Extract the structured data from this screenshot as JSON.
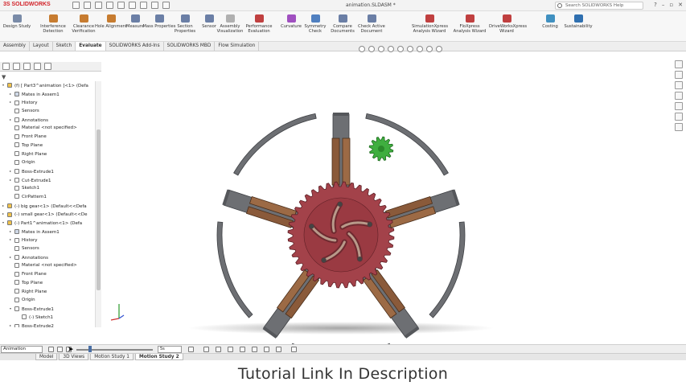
{
  "app": {
    "logo": "3S SOLIDWORKS",
    "document_title": "animation.SLDASM *",
    "search_placeholder": "Search SOLIDWORKS Help"
  },
  "ribbon": {
    "buttons": [
      {
        "label": "Design Study",
        "icon": "design-study-icon",
        "color": "#7a8ba8"
      },
      {
        "label": "Interference Detection",
        "icon": "interference-icon",
        "color": "#c77c30"
      },
      {
        "label": "Clearance Verification",
        "icon": "clearance-icon",
        "color": "#c77c30"
      },
      {
        "label": "Hole Alignment",
        "icon": "hole-icon",
        "color": "#c77c30"
      },
      {
        "label": "Measure",
        "icon": "measure-icon",
        "color": "#6b7fa6"
      },
      {
        "label": "Mass Properties",
        "icon": "mass-icon",
        "color": "#6b7fa6"
      },
      {
        "label": "Section Properties",
        "icon": "section-icon",
        "color": "#6b7fa6"
      },
      {
        "label": "Sensor",
        "icon": "sensor-icon",
        "color": "#6b7fa6"
      },
      {
        "label": "Assembly Visualization",
        "icon": "visualization-icon",
        "color": "#b0b0b0"
      },
      {
        "label": "Performance Evaluation",
        "icon": "performance-icon",
        "color": "#c04040"
      },
      {
        "label": "Curvature",
        "icon": "curvature-icon",
        "color": "#a050c0"
      },
      {
        "label": "Symmetry Check",
        "icon": "symmetry-icon",
        "color": "#5080c0"
      },
      {
        "label": "Compare Documents",
        "icon": "compare-icon",
        "color": "#6b7fa6"
      },
      {
        "label": "Check Active Document",
        "icon": "check-icon",
        "color": "#6b7fa6"
      },
      {
        "label": "SimulationXpress Analysis Wizard",
        "icon": "simxpress-icon",
        "color": "#c04040"
      },
      {
        "label": "FloXpress Analysis Wizard",
        "icon": "floxpress-icon",
        "color": "#c04040"
      },
      {
        "label": "DriveWorksXpress Wizard",
        "icon": "driveworks-icon",
        "color": "#c04040"
      },
      {
        "label": "Costing",
        "icon": "costing-icon",
        "color": "#4090c0"
      },
      {
        "label": "Sustainability",
        "icon": "sustainability-icon",
        "color": "#3070b0"
      }
    ]
  },
  "command_tabs": [
    "Assembly",
    "Layout",
    "Sketch",
    "Evaluate",
    "SOLIDWORKS Add-Ins",
    "SOLIDWORKS MBD",
    "Flow Simulation"
  ],
  "active_command_tab": "Evaluate",
  "tree": {
    "items": [
      {
        "label": "(f) [ Part3^animation ]<1> (Defa",
        "indent": 0,
        "arrow": "▾",
        "icon": "part-icon"
      },
      {
        "label": "Mates in Assem1",
        "indent": 1,
        "arrow": "▸",
        "icon": "mates-icon"
      },
      {
        "label": "History",
        "indent": 1,
        "arrow": "▸",
        "icon": "history-icon"
      },
      {
        "label": "Sensors",
        "indent": 1,
        "arrow": "",
        "icon": "sensors-icon"
      },
      {
        "label": "Annotations",
        "indent": 1,
        "arrow": "▸",
        "icon": "annotations-icon"
      },
      {
        "label": "Material <not specified>",
        "indent": 1,
        "arrow": "",
        "icon": "material-icon"
      },
      {
        "label": "Front Plane",
        "indent": 1,
        "arrow": "",
        "icon": "plane-icon"
      },
      {
        "label": "Top Plane",
        "indent": 1,
        "arrow": "",
        "icon": "plane-icon"
      },
      {
        "label": "Right Plane",
        "indent": 1,
        "arrow": "",
        "icon": "plane-icon"
      },
      {
        "label": "Origin",
        "indent": 1,
        "arrow": "",
        "icon": "origin-icon"
      },
      {
        "label": "Boss-Extrude1",
        "indent": 1,
        "arrow": "▸",
        "icon": "extrude-icon"
      },
      {
        "label": "Cut-Extrude1",
        "indent": 1,
        "arrow": "▸",
        "icon": "cut-icon"
      },
      {
        "label": "Sketch1",
        "indent": 1,
        "arrow": "",
        "icon": "sketch-icon"
      },
      {
        "label": "CirPattern1",
        "indent": 1,
        "arrow": "",
        "icon": "pattern-icon"
      },
      {
        "label": "(-) big gear<1> (Default<<Defa",
        "indent": 0,
        "arrow": "▸",
        "icon": "part-icon"
      },
      {
        "label": "(-) small gear<1> (Default<<De",
        "indent": 0,
        "arrow": "▸",
        "icon": "part-icon"
      },
      {
        "label": "(-) Part1^animation<1> (Defa",
        "indent": 0,
        "arrow": "▾",
        "icon": "part-icon"
      },
      {
        "label": "Mates in Assem1",
        "indent": 1,
        "arrow": "▸",
        "icon": "mates-icon"
      },
      {
        "label": "History",
        "indent": 1,
        "arrow": "▸",
        "icon": "history-icon"
      },
      {
        "label": "Sensors",
        "indent": 1,
        "arrow": "",
        "icon": "sensors-icon"
      },
      {
        "label": "Annotations",
        "indent": 1,
        "arrow": "▸",
        "icon": "annotations-icon"
      },
      {
        "label": "Material <not specified>",
        "indent": 1,
        "arrow": "",
        "icon": "material-icon"
      },
      {
        "label": "Front Plane",
        "indent": 1,
        "arrow": "",
        "icon": "plane-icon"
      },
      {
        "label": "Top Plane",
        "indent": 1,
        "arrow": "",
        "icon": "plane-icon"
      },
      {
        "label": "Right Plane",
        "indent": 1,
        "arrow": "",
        "icon": "plane-icon"
      },
      {
        "label": "Origin",
        "indent": 1,
        "arrow": "",
        "icon": "origin-icon"
      },
      {
        "label": "Boss-Extrude1",
        "indent": 1,
        "arrow": "▾",
        "icon": "extrude-icon"
      },
      {
        "label": "(-) Sketch1",
        "indent": 2,
        "arrow": "",
        "icon": "sketch-icon"
      },
      {
        "label": "Boss-Extrude2",
        "indent": 1,
        "arrow": "▸",
        "icon": "extrude-icon"
      }
    ]
  },
  "motion_manager": {
    "study_type": "Animation",
    "time": "5s"
  },
  "study_tabs": [
    "Model",
    "3D Views",
    "Motion Study 1",
    "Motion Study 2"
  ],
  "active_study_tab": "Motion Study 2",
  "caption": "Tutorial Link In Description",
  "colors": {
    "frame_gray": "#6d6f73",
    "wood_brown": "#8a5a3a",
    "big_gear": "#a3424a",
    "small_gear": "#3fae3f",
    "accent": "#d2232a"
  }
}
